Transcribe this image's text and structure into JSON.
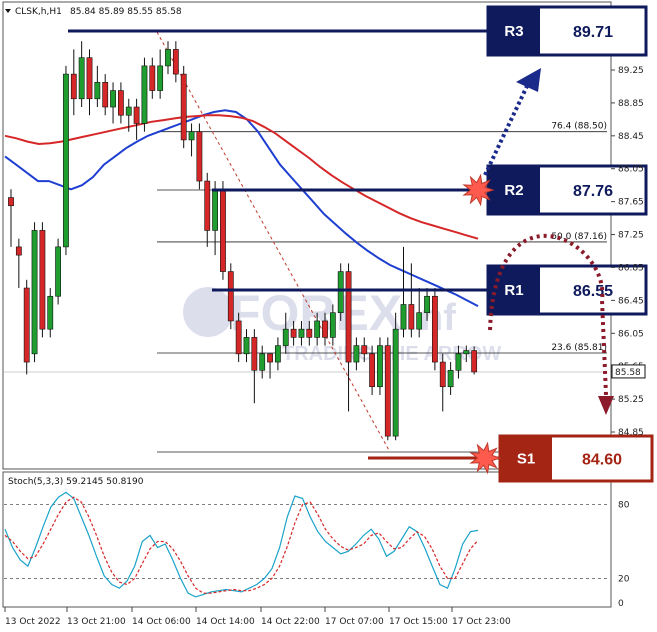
{
  "header": {
    "symbol": "CLSK,h,H1",
    "ohlc": "85.84 85.89 85.55 85.58",
    "indicator": "Stoch(5,3,3) 59.2145 50.8190"
  },
  "watermark": {
    "name": "FOREX",
    "suffix": "nf",
    "tagline": "TRADING THE ARROW"
  },
  "colors": {
    "bull": "#1f9e2f",
    "bear": "#d62728",
    "ma_fast": "#1f3fd1",
    "ma_slow": "#d62728",
    "level_dark": "#0f1a5c",
    "support": "#a52514",
    "stoch_main": "#1aa3c9",
    "stoch_signal": "#d62728",
    "arrow_r": "#1a2a8a",
    "arrow_s": "#8b1a2a"
  },
  "chart_data": [
    {
      "type": "candlestick",
      "title": "",
      "x_tick_labels": [
        "13 Oct 2022",
        "13 Oct 21:00",
        "14 Oct 06:00",
        "14 Oct 14:00",
        "14 Oct 22:00",
        "17 Oct 07:00",
        "17 Oct 15:00",
        "17 Oct 23:00"
      ],
      "y_ticks": [
        84.85,
        85.25,
        85.65,
        86.05,
        86.45,
        86.85,
        87.25,
        87.65,
        88.05,
        88.45,
        88.85,
        89.25
      ],
      "y_tick_labels": [
        "84.85",
        "85.25",
        "85.65",
        "86.05",
        "86.45",
        "86.85",
        "87.25",
        "87.65",
        "88.05",
        "88.45",
        "88.85",
        "89.25"
      ],
      "ylim": [
        84.72,
        89.62
      ],
      "current_price": "85.58",
      "candles": [
        [
          87.7,
          87.6,
          87.1,
          87.8
        ],
        [
          87.1,
          87.0,
          86.6,
          87.2
        ],
        [
          86.6,
          85.7,
          85.55,
          86.7
        ],
        [
          85.8,
          87.3,
          85.7,
          87.4
        ],
        [
          87.3,
          86.1,
          86.0,
          87.4
        ],
        [
          86.1,
          86.5,
          86.0,
          86.6
        ],
        [
          86.5,
          87.1,
          86.4,
          87.2
        ],
        [
          87.1,
          89.2,
          87.0,
          89.3
        ],
        [
          89.2,
          88.9,
          88.7,
          89.5
        ],
        [
          88.9,
          89.4,
          88.8,
          89.6
        ],
        [
          89.4,
          88.9,
          88.7,
          89.5
        ],
        [
          88.9,
          89.1,
          88.8,
          89.3
        ],
        [
          89.1,
          88.8,
          88.7,
          89.2
        ],
        [
          88.8,
          89.0,
          88.6,
          89.1
        ],
        [
          89.0,
          88.7,
          88.6,
          89.1
        ],
        [
          88.7,
          88.8,
          88.5,
          88.9
        ],
        [
          88.8,
          88.6,
          88.4,
          88.9
        ],
        [
          88.6,
          89.3,
          88.5,
          89.4
        ],
        [
          89.3,
          89.0,
          88.9,
          89.4
        ],
        [
          89.0,
          89.3,
          88.9,
          89.5
        ],
        [
          89.3,
          89.5,
          89.2,
          89.6
        ],
        [
          89.5,
          89.2,
          89.1,
          89.6
        ],
        [
          89.2,
          88.4,
          88.3,
          89.3
        ],
        [
          88.4,
          88.5,
          88.2,
          88.6
        ],
        [
          88.5,
          87.9,
          87.8,
          88.6
        ],
        [
          87.9,
          87.3,
          87.1,
          88.0
        ],
        [
          87.3,
          87.8,
          87.0,
          87.9
        ],
        [
          87.8,
          86.8,
          86.7,
          87.9
        ],
        [
          86.8,
          86.2,
          86.1,
          86.9
        ],
        [
          86.2,
          85.8,
          85.7,
          86.3
        ],
        [
          85.8,
          86.0,
          85.7,
          86.1
        ],
        [
          86.0,
          85.6,
          85.2,
          86.1
        ],
        [
          85.6,
          85.8,
          85.5,
          85.9
        ],
        [
          85.8,
          85.7,
          85.5,
          85.8
        ],
        [
          85.7,
          85.9,
          85.6,
          86.0
        ],
        [
          85.9,
          86.1,
          85.8,
          86.3
        ],
        [
          86.1,
          86.0,
          85.9,
          86.2
        ],
        [
          86.0,
          86.1,
          85.9,
          86.2
        ],
        [
          86.1,
          86.0,
          85.9,
          86.2
        ],
        [
          86.0,
          86.2,
          85.9,
          86.3
        ],
        [
          86.2,
          86.0,
          85.9,
          86.3
        ],
        [
          86.0,
          86.3,
          85.9,
          86.4
        ],
        [
          86.3,
          86.8,
          86.2,
          86.9
        ],
        [
          86.8,
          85.7,
          85.1,
          86.9
        ],
        [
          85.7,
          85.9,
          85.6,
          86.0
        ],
        [
          85.9,
          85.8,
          85.7,
          86.0
        ],
        [
          85.8,
          85.4,
          85.3,
          85.9
        ],
        [
          85.4,
          85.9,
          85.3,
          86.0
        ],
        [
          85.9,
          84.8,
          84.75,
          86.0
        ],
        [
          84.8,
          86.1,
          84.75,
          86.3
        ],
        [
          86.1,
          86.4,
          86.0,
          87.1
        ],
        [
          86.4,
          86.1,
          86.0,
          86.9
        ],
        [
          86.1,
          86.3,
          86.0,
          86.6
        ],
        [
          86.3,
          86.5,
          86.2,
          86.6
        ],
        [
          86.5,
          85.7,
          85.6,
          86.6
        ],
        [
          85.7,
          85.4,
          85.1,
          85.8
        ],
        [
          85.4,
          85.6,
          85.3,
          85.7
        ],
        [
          85.6,
          85.8,
          85.5,
          85.9
        ],
        [
          85.8,
          85.84,
          85.7,
          85.9
        ],
        [
          85.84,
          85.58,
          85.55,
          85.89
        ]
      ],
      "moving_averages": [
        {
          "values": [
            88.2,
            88.1,
            88.0,
            87.9,
            87.9,
            87.85,
            87.8,
            87.85,
            87.95,
            88.1,
            88.2,
            88.3,
            88.38,
            88.45,
            88.5,
            88.55,
            88.6,
            88.65,
            88.7,
            88.74,
            88.76,
            88.74,
            88.65,
            88.5,
            88.3,
            88.1,
            87.95,
            87.8,
            87.65,
            87.5,
            87.38,
            87.26,
            87.15,
            87.05,
            86.96,
            86.88,
            86.82,
            86.76,
            86.7,
            86.64,
            86.58,
            86.52,
            86.45,
            86.38
          ]
        },
        {
          "values": [
            88.45,
            88.42,
            88.38,
            88.35,
            88.36,
            88.38,
            88.41,
            88.44,
            88.47,
            88.5,
            88.53,
            88.56,
            88.59,
            88.62,
            88.64,
            88.66,
            88.68,
            88.69,
            88.7,
            88.7,
            88.69,
            88.67,
            88.63,
            88.56,
            88.48,
            88.38,
            88.28,
            88.18,
            88.07,
            87.97,
            87.88,
            87.8,
            87.72,
            87.65,
            87.58,
            87.51,
            87.45,
            87.4,
            87.36,
            87.32,
            87.28,
            87.24,
            87.2
          ]
        }
      ],
      "fibonacci": [
        {
          "label": "76.4 (88.50)",
          "value": 88.5
        },
        {
          "label": "50.0 (87.16)",
          "value": 87.16
        },
        {
          "label": "23.6 (85.81)",
          "value": 85.81
        }
      ],
      "levels": [
        {
          "name": "R3",
          "value": "89.71",
          "y": 89.71
        },
        {
          "name": "R2",
          "value": "87.76",
          "y": 87.76
        },
        {
          "name": "R1",
          "value": "86.55",
          "y": 86.55
        },
        {
          "name": "S1",
          "value": "84.60",
          "y": 84.6
        }
      ]
    },
    {
      "type": "line",
      "title": "Stoch(5,3,3)",
      "y_ticks": [
        0,
        20,
        80
      ],
      "y_tick_labels": [
        "0",
        "20",
        "80"
      ],
      "ylim": [
        -3,
        104
      ],
      "series": [
        {
          "values": [
            60,
            45,
            35,
            30,
            45,
            62,
            78,
            86,
            90,
            85,
            70,
            55,
            38,
            22,
            15,
            12,
            18,
            30,
            50,
            55,
            45,
            48,
            35,
            20,
            8,
            5,
            7,
            9,
            10,
            11,
            10,
            9,
            12,
            15,
            20,
            28,
            45,
            70,
            87,
            85,
            70,
            58,
            50,
            45,
            40,
            42,
            48,
            55,
            60,
            52,
            38,
            42,
            52,
            62,
            58,
            45,
            30,
            15,
            12,
            28,
            48,
            58,
            59
          ]
        },
        {
          "values": [
            55,
            50,
            42,
            36,
            38,
            48,
            60,
            72,
            82,
            86,
            82,
            70,
            55,
            38,
            25,
            17,
            15,
            20,
            32,
            44,
            50,
            50,
            44,
            34,
            22,
            12,
            8,
            8,
            9,
            10,
            11,
            10,
            10,
            12,
            15,
            20,
            30,
            46,
            65,
            80,
            82,
            72,
            60,
            52,
            46,
            43,
            45,
            48,
            55,
            57,
            50,
            44,
            45,
            52,
            58,
            54,
            44,
            30,
            20,
            20,
            32,
            44,
            51
          ]
        }
      ]
    }
  ]
}
